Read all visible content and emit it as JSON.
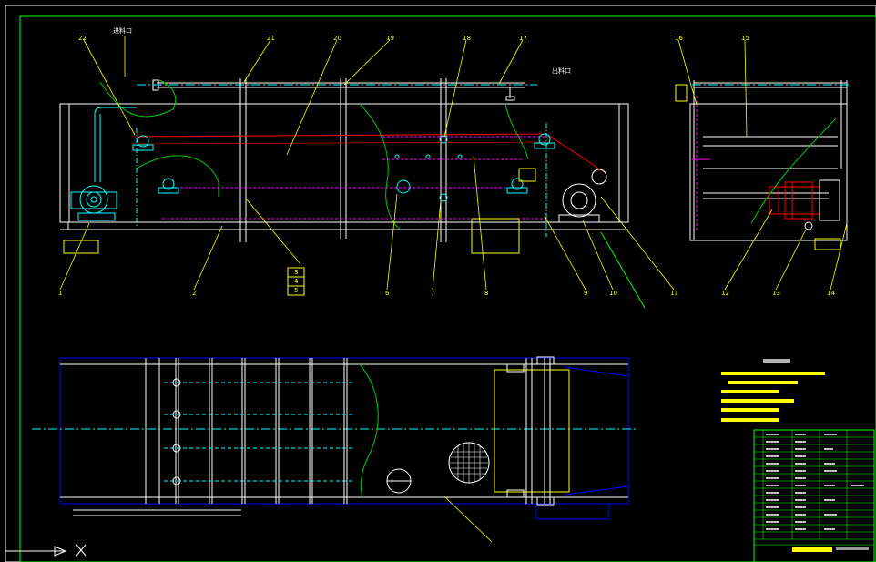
{
  "drawing": {
    "inlet_label": "进料口",
    "outlet_label": "出料口",
    "part_numbers": [
      "1",
      "2",
      "3",
      "4",
      "5",
      "6",
      "7",
      "8",
      "9",
      "10",
      "11",
      "12",
      "13",
      "14",
      "15",
      "16",
      "17",
      "18",
      "19",
      "20",
      "21",
      "22"
    ]
  },
  "colors": {
    "background": "#000000",
    "frame": "#ffffff",
    "border_green": "#00ff00",
    "leader_yellow": "#ffff00",
    "machine_cyan": "#00ffff",
    "belt_red": "#ff0000",
    "magenta": "#ff00ff",
    "plan_blue": "#0000ff",
    "breakline_green": "#00cc00"
  }
}
